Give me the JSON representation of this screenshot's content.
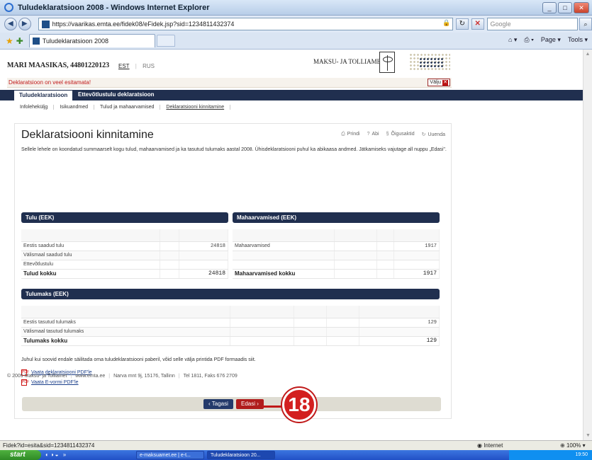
{
  "window": {
    "title": "Tuludeklaratsioon 2008 - Windows Internet Explorer",
    "url": "https://vaarikas.emta.ee/fidek08/eFidek.jsp?sid=1234811432374",
    "search_placeholder": "Google",
    "tab_title": "Tuludeklaratsioon 2008",
    "cmd_page": "Page",
    "cmd_tools": "Tools"
  },
  "header": {
    "user": "MARI MAASIKAS, 44801220123",
    "lang_est": "EST",
    "lang_rus": "RUS",
    "logo_text": "MAKSU- JA TOLLIAMET"
  },
  "notice": {
    "text": "Deklaratsioon on veel esitamata!",
    "exit_label": "Välju"
  },
  "main_nav": {
    "active": "Tuludeklaratsioon",
    "other": "Ettevõtlustulu deklaratsioon"
  },
  "sub_nav": [
    "Infoleheküljg",
    "Isikuandmed",
    "Tulud ja mahaarvamised",
    "Deklaratsiooni kinnitamine"
  ],
  "content": {
    "title": "Deklaratsiooni kinnitamine",
    "tools": {
      "print": "Prindi",
      "help": "Abi",
      "rights": "Õigusaktid",
      "refresh": "Uuenda"
    },
    "intro": "Sellele lehele on koondatud summaarselt kogu tulud, mahaarvamised ja ka tasutud tulumaks aastal 2008. Ühisdeklaratsiooni puhul ka abikaasa andmed. Jätkamiseks vajutage all nuppu „Edasi\".",
    "income": {
      "header": "Tulu (EEK)",
      "rows": [
        {
          "label": "Eestis saadud tulu",
          "value": "24818"
        },
        {
          "label": "Välismaal saadud tulu",
          "value": ""
        },
        {
          "label": "Ettevõtlustulu",
          "value": ""
        }
      ],
      "total_label": "Tulud kokku",
      "total_value": "24818"
    },
    "deductions": {
      "header": "Mahaarvamised (EEK)",
      "rows": [
        {
          "label": "Mahaarvamised",
          "value": "1917"
        },
        {
          "label": "",
          "value": ""
        },
        {
          "label": "",
          "value": ""
        }
      ],
      "total_label": "Mahaarvamised kokku",
      "total_value": "1917"
    },
    "tax": {
      "header": "Tulumaks (EEK)",
      "rows": [
        {
          "label": "Eestis tasutud tulumaks",
          "value": "129"
        },
        {
          "label": "Välismaal tasutud tulumaks",
          "value": ""
        }
      ],
      "total_label": "Tulumaks kokku",
      "total_value": "129"
    },
    "pdf_note": "Juhul kui soovid endale säilitada oma tuludeklaratsiooni paberil, võid selle välja printida PDF formaadis siit.",
    "pdf_links": [
      "Vaata deklaratsiooni PDF'le",
      "Vaata E-vormi PDF'le"
    ],
    "back_label": "‹ Tagasi",
    "next_label": "Edasi ›"
  },
  "callout_number": "18",
  "footer": {
    "copyright": "© 2009 Maksu- ja Tolliamet",
    "site": "www.emta.ee",
    "address": "Narva mnt 9j, 15176, Tallinn",
    "phone": "Tel 1811, Faks 676 2709"
  },
  "statusbar": {
    "text": "Fidek?id=esita&sid=1234811432374",
    "zone": "Internet",
    "zoom": "100%"
  },
  "taskbar": {
    "start": "start",
    "tasks": [
      "e-maksuamet.ee | e-t...",
      "Tuludeklaratsioon 20..."
    ],
    "clock": "19:50"
  },
  "colors": {
    "nav_dark": "#202f4f",
    "accent_red": "#b01c1c",
    "callout_red": "#d31f1f"
  }
}
